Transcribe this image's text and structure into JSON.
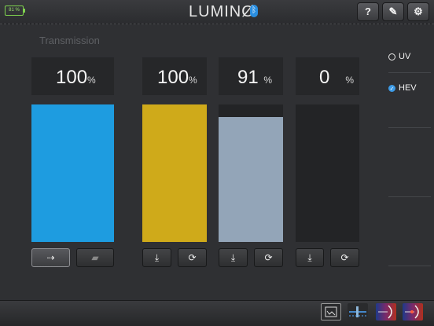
{
  "header": {
    "battery": "81 %",
    "logo": "LUMINØ",
    "bluetooth_glyph": "ᛒ",
    "help_label": "?",
    "edit_glyph": "✎",
    "settings_glyph": "⚙"
  },
  "main": {
    "title": "Transmission",
    "total": {
      "value": "100",
      "unit": "%",
      "fill": 1.0,
      "color": "#1e9ce0"
    },
    "channels": [
      {
        "value": "100",
        "unit": "%",
        "fill": 1.0,
        "color": "#cfaa1a"
      },
      {
        "value": "91",
        "unit": "%",
        "fill": 0.91,
        "color": "#93a5b8"
      },
      {
        "value": "0",
        "unit": "%",
        "fill": 0.0,
        "color": "#232426"
      }
    ],
    "download_glyph": "⤓",
    "reset_glyph": "⟳",
    "left_toggle_glyph": "⇢",
    "right_toggle_glyph": "▰"
  },
  "options": {
    "uv_label": "UV",
    "hev_label": "HEV",
    "hev_checked": true,
    "uv_checked": false
  },
  "colors": {
    "accent": "#2a8ee0",
    "total_bar": "#1e9ce0",
    "yellow_bar": "#cfaa1a",
    "grey_bar": "#93a5b8"
  }
}
